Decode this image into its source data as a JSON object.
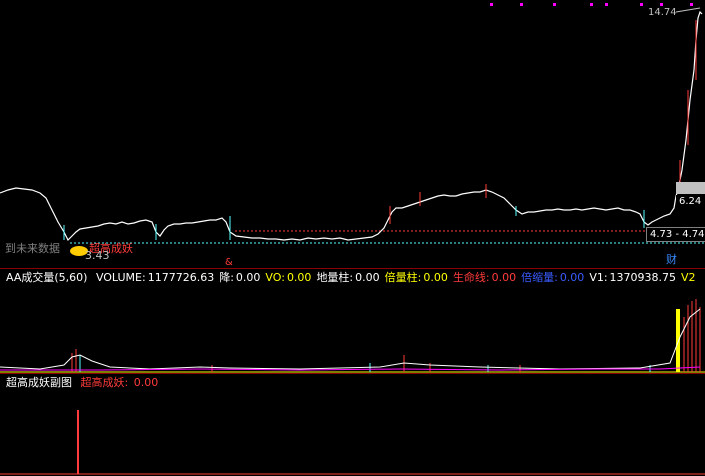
{
  "colors": {
    "background": "#000000",
    "candle_up": "#ff3b3b",
    "candle_down": "#54ffff",
    "ma_white": "#ffffff",
    "ma_yellow": "#ffff00",
    "magenta": "#ff00ff",
    "separator": "#8b0000"
  },
  "price_pane": {
    "high_label": "14.74",
    "low_label": "3.43",
    "current_price_tag": "6.24",
    "range_tag": "4.73 - 4.74",
    "future_data_text": "到未来数据",
    "signal_label": "超高成妖",
    "marker_1": "&",
    "marker_2": "财"
  },
  "volume_pane": {
    "title": "AA成交量(5,60)",
    "fields": [
      {
        "label": "VOLUME:",
        "value": "1177726.63",
        "color": "#ffffff"
      },
      {
        "label": "降:",
        "value": "0.00",
        "color": "#ffffff"
      },
      {
        "label": "VO:",
        "value": "0.00",
        "color": "#ffff00"
      },
      {
        "label": "地量柱:",
        "value": "0.00",
        "color": "#ffffff"
      },
      {
        "label": "倍量柱:",
        "value": "0.00",
        "color": "#ffff00"
      },
      {
        "label": "生命线:",
        "value": "0.00",
        "color": "#ff3b3b"
      },
      {
        "label": "倍缩量:",
        "value": "0.00",
        "color": "#3a5bff"
      },
      {
        "label": "V1:",
        "value": "1370938.75",
        "color": "#ffffff"
      },
      {
        "label": "V2",
        "value": "",
        "color": "#ffff00"
      }
    ]
  },
  "sub_pane": {
    "title": "超高成妖副图",
    "field_label": "超高成妖:",
    "field_value": "0.00"
  }
}
